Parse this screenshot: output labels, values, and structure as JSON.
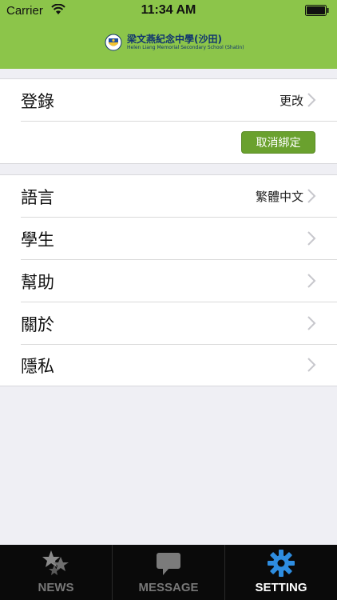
{
  "status_bar": {
    "carrier": "Carrier",
    "time": "11:34 AM"
  },
  "header": {
    "school_name": "梁文燕紀念中學(沙田)",
    "school_name_en": "Helen Liang Memorial Secondary School (Shatin)"
  },
  "login_group": {
    "label": "登錄",
    "value": "更改",
    "unbind_label": "取消綁定"
  },
  "settings_group": {
    "items": [
      {
        "label": "語言",
        "value": "繁體中文"
      },
      {
        "label": "學生",
        "value": ""
      },
      {
        "label": "幫助",
        "value": ""
      },
      {
        "label": "關於",
        "value": ""
      },
      {
        "label": "隱私",
        "value": ""
      }
    ]
  },
  "tab_bar": {
    "tabs": [
      {
        "label": "NEWS",
        "icon": "stars-icon"
      },
      {
        "label": "MESSAGE",
        "icon": "speech-bubble-icon"
      },
      {
        "label": "SETTING",
        "icon": "gear-icon"
      }
    ],
    "active": "SETTING"
  },
  "colors": {
    "header_green": "#8cc54a",
    "button_green": "#6aa12e",
    "gear_blue": "#2e8de0",
    "tabbar_black": "#0a0a0a"
  }
}
